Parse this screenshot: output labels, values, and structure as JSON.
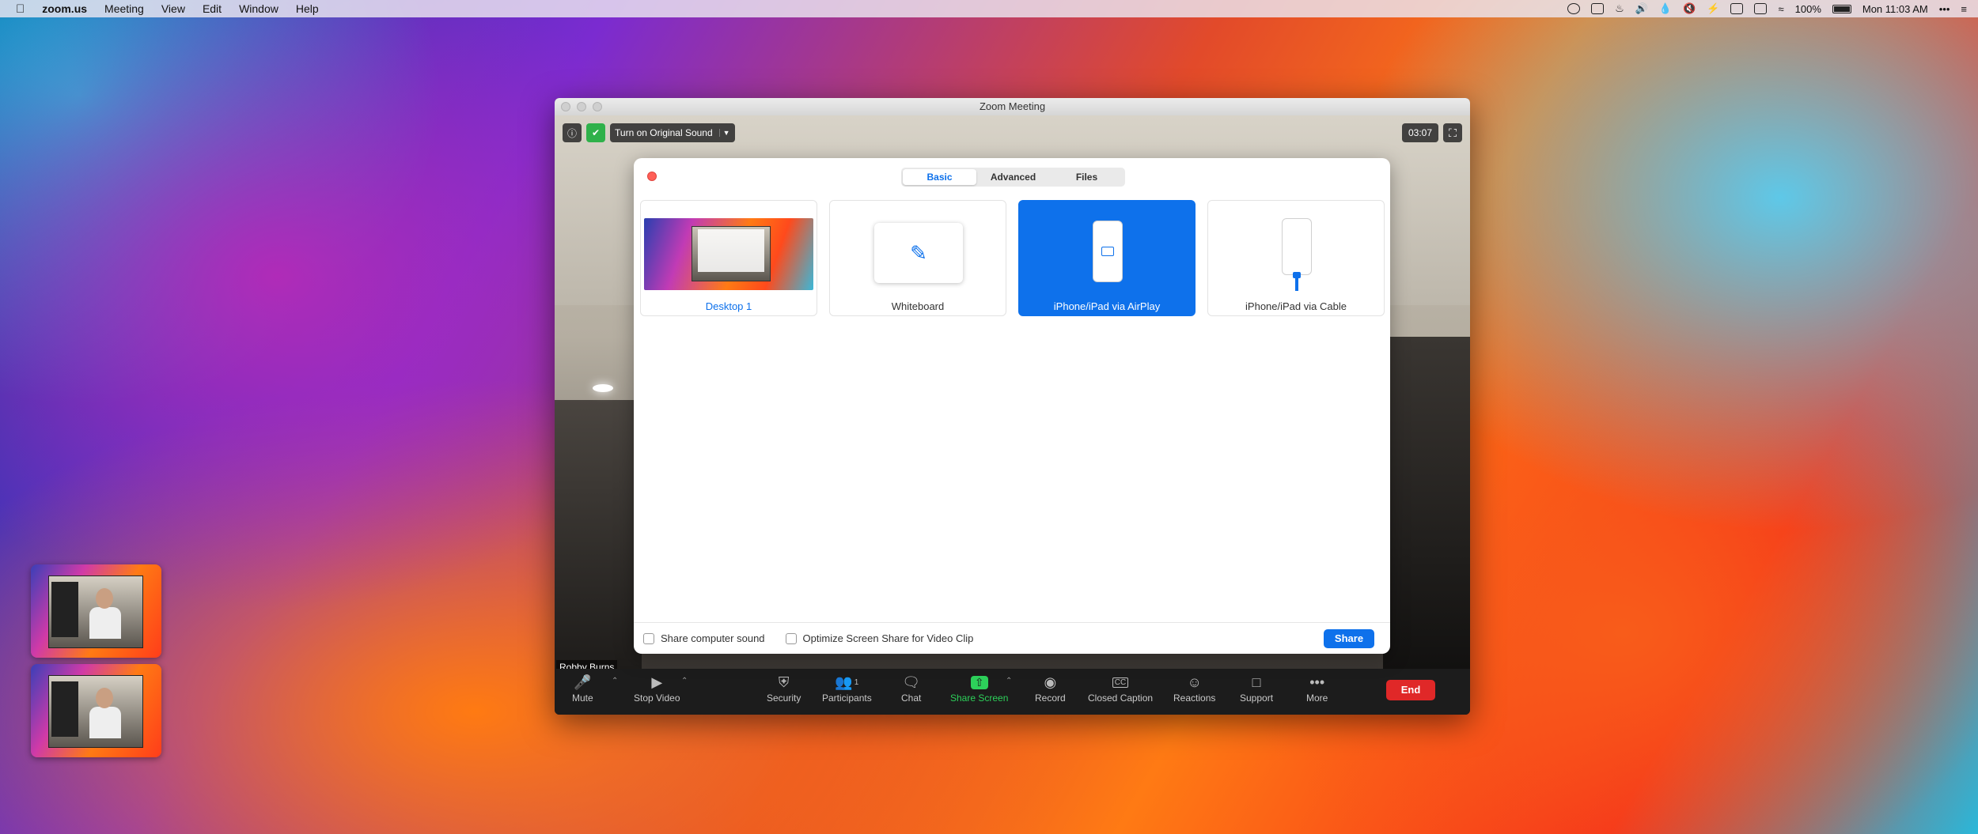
{
  "menubar": {
    "app": "zoom.us",
    "items": [
      "Meeting",
      "View",
      "Edit",
      "Window",
      "Help"
    ],
    "battery": "100%",
    "clock": "Mon 11:03 AM"
  },
  "window": {
    "title": "Zoom Meeting",
    "original_sound_label": "Turn on Original Sound",
    "timer": "03:07",
    "participant_name": "Robby Burns"
  },
  "share_dialog": {
    "tabs": [
      "Basic",
      "Advanced",
      "Files"
    ],
    "active_tab": "Basic",
    "options": [
      {
        "label": "Desktop 1",
        "selected": false
      },
      {
        "label": "Whiteboard",
        "selected": false
      },
      {
        "label": "iPhone/iPad via AirPlay",
        "selected": true
      },
      {
        "label": "iPhone/iPad via Cable",
        "selected": false
      }
    ],
    "share_sound_label": "Share computer sound",
    "optimize_label": "Optimize Screen Share for Video Clip",
    "share_button": "Share"
  },
  "toolbar": {
    "mute": "Mute",
    "stop_video": "Stop Video",
    "security": "Security",
    "participants": "Participants",
    "participant_count": "1",
    "chat": "Chat",
    "share_screen": "Share Screen",
    "record": "Record",
    "closed_caption": "Closed Caption",
    "reactions": "Reactions",
    "support": "Support",
    "more": "More",
    "end": "End"
  },
  "colors": {
    "zoom_blue": "#0e71eb",
    "share_green": "#2dd05a",
    "end_red": "#e02828"
  }
}
